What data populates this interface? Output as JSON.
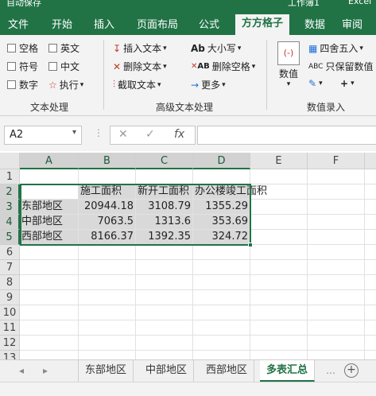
{
  "titlebar": {
    "left": "自动保存",
    "center": "工作簿1",
    "right": "Excel"
  },
  "tabs": [
    "文件",
    "开始",
    "插入",
    "页面布局",
    "公式",
    "方方格子",
    "数据",
    "审阅"
  ],
  "active_tab": "方方格子",
  "ribbon": {
    "group1": {
      "checkboxes": [
        "空格",
        "英文",
        "符号",
        "中文",
        "数字"
      ],
      "exec_label": "执行",
      "label": "文本处理"
    },
    "group2": {
      "items": [
        "插入文本",
        "删除文本",
        "截取文本",
        "大小写",
        "删除空格",
        "更多"
      ],
      "label": "高级文本处理"
    },
    "group3": {
      "big_label": "数值",
      "items": [
        "四舍五入",
        "只保留数值"
      ],
      "label": "数值录入"
    }
  },
  "formula_bar": {
    "name_box": "A2",
    "fx": "fx",
    "value": ""
  },
  "columns": [
    "A",
    "B",
    "C",
    "D",
    "E",
    "F"
  ],
  "rows": [
    "1",
    "2",
    "3",
    "4",
    "5",
    "6",
    "7",
    "8",
    "9",
    "10",
    "11",
    "12",
    "13"
  ],
  "table": {
    "headers": [
      "",
      "施工面积",
      "新开工面积",
      "办公楼竣工面积"
    ],
    "rows": [
      [
        "东部地区",
        "20944.18",
        "3108.79",
        "1355.29"
      ],
      [
        "中部地区",
        "7063.5",
        "1313.6",
        "353.69"
      ],
      [
        "西部地区",
        "8166.37",
        "1392.35",
        "324.72"
      ]
    ]
  },
  "sheets": [
    "东部地区",
    "中部地区",
    "西部地区",
    "多表汇总"
  ],
  "active_sheet": "多表汇总",
  "colors": {
    "accent": "#217346"
  }
}
